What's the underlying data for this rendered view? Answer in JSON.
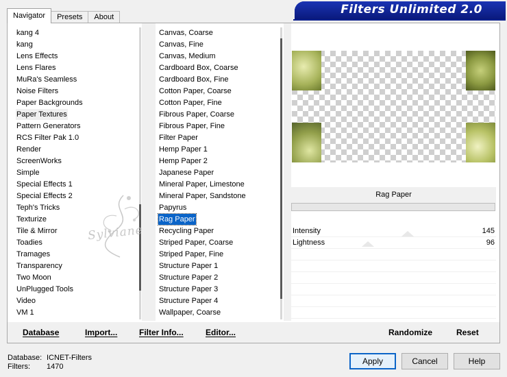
{
  "tabs": [
    {
      "label": "Navigator",
      "active": true
    },
    {
      "label": "Presets",
      "active": false
    },
    {
      "label": "About",
      "active": false
    }
  ],
  "banner": {
    "title": "Filters Unlimited 2.0",
    "color": "#0c1f8c"
  },
  "categories": {
    "items": [
      "kang 4",
      "kang",
      "Lens Effects",
      "Lens Flares",
      "MuRa's Seamless",
      "Noise Filters",
      "Paper Backgrounds",
      "Paper Textures",
      "Pattern Generators",
      "RCS Filter Pak 1.0",
      "Render",
      "ScreenWorks",
      "Simple",
      "Special Effects 1",
      "Special Effects 2",
      "Teph's Tricks",
      "Texturize",
      "Tile & Mirror",
      "Toadies",
      "Tramages",
      "Transparency",
      "Two Moon",
      "UnPlugged Tools",
      "Video",
      "VM 1"
    ],
    "selected": "Paper Textures"
  },
  "filters": {
    "items": [
      "Canvas, Coarse",
      "Canvas, Fine",
      "Canvas, Medium",
      "Cardboard Box, Coarse",
      "Cardboard Box, Fine",
      "Cotton Paper, Coarse",
      "Cotton Paper, Fine",
      "Fibrous Paper, Coarse",
      "Fibrous Paper, Fine",
      "Filter Paper",
      "Hemp Paper 1",
      "Hemp Paper 2",
      "Japanese Paper",
      "Mineral Paper, Limestone",
      "Mineral Paper, Sandstone",
      "Papyrus",
      "Rag Paper",
      "Recycling Paper",
      "Striped Paper, Coarse",
      "Striped Paper, Fine",
      "Structure Paper 1",
      "Structure Paper 2",
      "Structure Paper 3",
      "Structure Paper 4",
      "Wallpaper, Coarse"
    ],
    "selected": "Rag Paper",
    "selected_color": "#0a64c8"
  },
  "preview": {
    "filter_name": "Rag Paper",
    "progress": 0
  },
  "params": [
    {
      "label": "Intensity",
      "value": "145"
    },
    {
      "label": "Lightness",
      "value": "96"
    }
  ],
  "toolbar": {
    "database": "Database",
    "import": "Import...",
    "filter_info": "Filter Info...",
    "editor": "Editor...",
    "randomize": "Randomize",
    "reset": "Reset"
  },
  "status": {
    "database_label": "Database:",
    "database_value": "ICNET-Filters",
    "filters_label": "Filters:",
    "filters_value": "1470"
  },
  "buttons": {
    "apply": "Apply",
    "cancel": "Cancel",
    "help": "Help"
  },
  "watermark": {
    "text": "Sylviane"
  }
}
